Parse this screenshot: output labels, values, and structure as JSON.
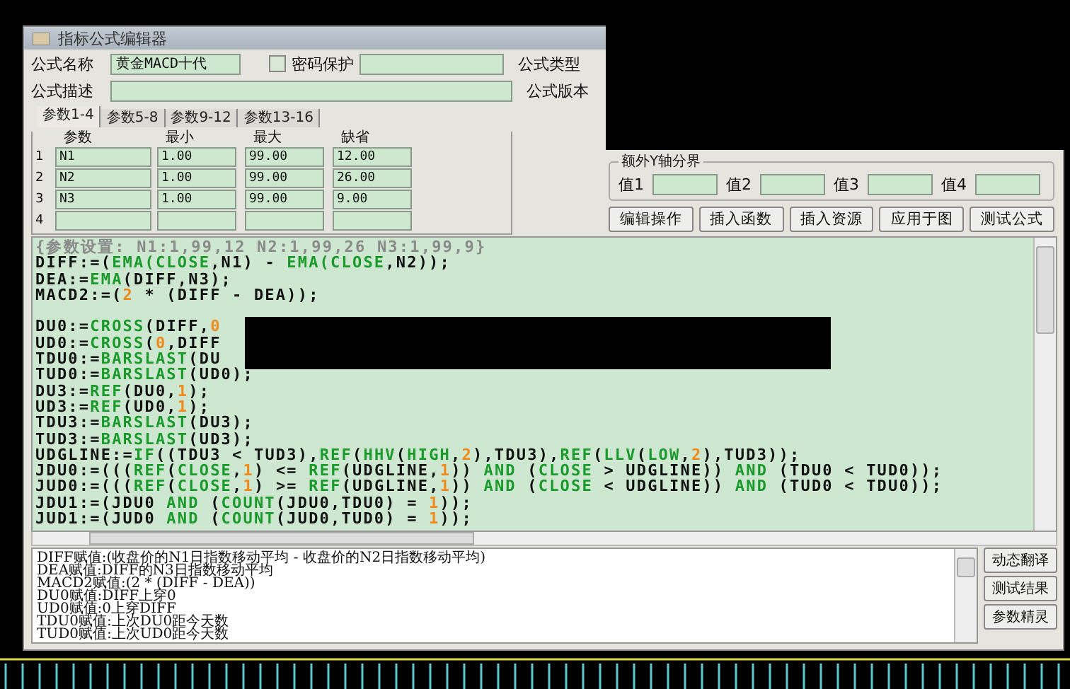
{
  "window": {
    "title": "指标公式编辑器"
  },
  "form": {
    "name_label": "公式名称",
    "name_value": "黄金MACD十代",
    "password": {
      "label": "密码保护",
      "checked": false
    },
    "type_label": "公式类型",
    "desc_label": "公式描述",
    "version_label": "公式版本"
  },
  "tabs": [
    {
      "label": "参数1-4",
      "selected": true
    },
    {
      "label": "参数5-8",
      "selected": false
    },
    {
      "label": "参数9-12",
      "selected": false
    },
    {
      "label": "参数13-16",
      "selected": false
    }
  ],
  "params": {
    "columns": [
      "参数",
      "最小",
      "最大",
      "缺省"
    ],
    "rows": [
      {
        "index": "1",
        "cells": [
          "N1",
          "1.00",
          "99.00",
          "12.00"
        ]
      },
      {
        "index": "2",
        "cells": [
          "N2",
          "1.00",
          "99.00",
          "26.00"
        ]
      },
      {
        "index": "3",
        "cells": [
          "N3",
          "1.00",
          "99.00",
          "9.00"
        ]
      },
      {
        "index": "4",
        "cells": []
      }
    ]
  },
  "y_axis": {
    "title": "额外Y轴分界",
    "values": [
      "值1",
      "值2",
      "值3",
      "值4"
    ]
  },
  "buttons": [
    "编辑操作",
    "插入函数",
    "插入资源",
    "应用于图",
    "测试公式"
  ],
  "code": {
    "lines": [
      {
        "kind": "code",
        "segments": [
          {
            "text": "{参数设置: N1:1,99,12 N2:1,99,26 N3:1,99,9}",
            "kind": "comment"
          }
        ]
      },
      {
        "kind": "code",
        "segments": [
          {
            "text": "DIFF:=(",
            "kind": "plain"
          },
          {
            "text": "EMA(CLOSE",
            "kind": "func"
          },
          {
            "text": ",N1) - ",
            "kind": "plain"
          },
          {
            "text": "EMA(CLOSE",
            "kind": "func"
          },
          {
            "text": ",N2));",
            "kind": "plain"
          }
        ]
      },
      {
        "kind": "code",
        "segments": [
          {
            "text": "DEA:=",
            "kind": "plain"
          },
          {
            "text": "EMA",
            "kind": "func"
          },
          {
            "text": "(DIFF,N3);",
            "kind": "plain"
          }
        ]
      },
      {
        "kind": "code",
        "segments": [
          {
            "text": "MACD2:=(",
            "kind": "plain"
          },
          {
            "text": "2",
            "kind": "num"
          },
          {
            "text": " * (DIFF - DEA));",
            "kind": "plain"
          }
        ]
      },
      {
        "kind": "blank"
      },
      {
        "kind": "code",
        "segments": [
          {
            "text": "DU0:=",
            "kind": "plain"
          },
          {
            "text": "CROSS",
            "kind": "func"
          },
          {
            "text": "(DIFF,",
            "kind": "plain"
          },
          {
            "text": "0",
            "kind": "num"
          }
        ]
      },
      {
        "kind": "code",
        "segments": [
          {
            "text": "UD0:=",
            "kind": "plain"
          },
          {
            "text": "CROSS",
            "kind": "func"
          },
          {
            "text": "(",
            "kind": "plain"
          },
          {
            "text": "0",
            "kind": "num"
          },
          {
            "text": ",DIFF",
            "kind": "plain"
          }
        ]
      },
      {
        "kind": "code",
        "segments": [
          {
            "text": "TDU0:=",
            "kind": "plain"
          },
          {
            "text": "BARSLAST",
            "kind": "func"
          },
          {
            "text": "(DU",
            "kind": "plain"
          }
        ]
      },
      {
        "kind": "code",
        "segments": [
          {
            "text": "TUD0:=",
            "kind": "plain"
          },
          {
            "text": "BARSLAST",
            "kind": "func"
          },
          {
            "text": "(UD0);",
            "kind": "plain"
          }
        ]
      },
      {
        "kind": "code",
        "segments": [
          {
            "text": "DU3:=",
            "kind": "plain"
          },
          {
            "text": "REF",
            "kind": "func"
          },
          {
            "text": "(DU0,",
            "kind": "plain"
          },
          {
            "text": "1",
            "kind": "num"
          },
          {
            "text": ");",
            "kind": "plain"
          }
        ]
      },
      {
        "kind": "code",
        "segments": [
          {
            "text": "UD3:=",
            "kind": "plain"
          },
          {
            "text": "REF",
            "kind": "func"
          },
          {
            "text": "(UD0,",
            "kind": "plain"
          },
          {
            "text": "1",
            "kind": "num"
          },
          {
            "text": ");",
            "kind": "plain"
          }
        ]
      },
      {
        "kind": "code",
        "segments": [
          {
            "text": "TDU3:=",
            "kind": "plain"
          },
          {
            "text": "BARSLAST",
            "kind": "func"
          },
          {
            "text": "(DU3);",
            "kind": "plain"
          }
        ]
      },
      {
        "kind": "code",
        "segments": [
          {
            "text": "TUD3:=",
            "kind": "plain"
          },
          {
            "text": "BARSLAST",
            "kind": "func"
          },
          {
            "text": "(UD3);",
            "kind": "plain"
          }
        ]
      },
      {
        "kind": "code",
        "segments": [
          {
            "text": "UDGLINE:=",
            "kind": "plain"
          },
          {
            "text": "IF",
            "kind": "func"
          },
          {
            "text": "((TDU3 < TUD3),",
            "kind": "plain"
          },
          {
            "text": "REF",
            "kind": "func"
          },
          {
            "text": "(",
            "kind": "plain"
          },
          {
            "text": "HHV",
            "kind": "func"
          },
          {
            "text": "(",
            "kind": "plain"
          },
          {
            "text": "HIGH",
            "kind": "func"
          },
          {
            "text": ",",
            "kind": "plain"
          },
          {
            "text": "2",
            "kind": "num"
          },
          {
            "text": "),TDU3),",
            "kind": "plain"
          },
          {
            "text": "REF",
            "kind": "func"
          },
          {
            "text": "(",
            "kind": "plain"
          },
          {
            "text": "LLV",
            "kind": "func"
          },
          {
            "text": "(",
            "kind": "plain"
          },
          {
            "text": "LOW",
            "kind": "func"
          },
          {
            "text": ",",
            "kind": "plain"
          },
          {
            "text": "2",
            "kind": "num"
          },
          {
            "text": "),TUD3));",
            "kind": "plain"
          }
        ]
      },
      {
        "kind": "code",
        "segments": [
          {
            "text": "JDU0:=(((",
            "kind": "plain"
          },
          {
            "text": "REF",
            "kind": "func"
          },
          {
            "text": "(",
            "kind": "plain"
          },
          {
            "text": "CLOSE",
            "kind": "func"
          },
          {
            "text": ",",
            "kind": "plain"
          },
          {
            "text": "1",
            "kind": "num"
          },
          {
            "text": ") <= ",
            "kind": "plain"
          },
          {
            "text": "REF",
            "kind": "func"
          },
          {
            "text": "(UDGLINE,",
            "kind": "plain"
          },
          {
            "text": "1",
            "kind": "num"
          },
          {
            "text": ")) ",
            "kind": "plain"
          },
          {
            "text": "AND",
            "kind": "func"
          },
          {
            "text": " (",
            "kind": "plain"
          },
          {
            "text": "CLOSE",
            "kind": "func"
          },
          {
            "text": " > UDGLINE)) ",
            "kind": "plain"
          },
          {
            "text": "AND",
            "kind": "func"
          },
          {
            "text": " (TDU0 < TUD0));",
            "kind": "plain"
          }
        ]
      },
      {
        "kind": "code",
        "segments": [
          {
            "text": "JUD0:=(((",
            "kind": "plain"
          },
          {
            "text": "REF",
            "kind": "func"
          },
          {
            "text": "(",
            "kind": "plain"
          },
          {
            "text": "CLOSE",
            "kind": "func"
          },
          {
            "text": ",",
            "kind": "plain"
          },
          {
            "text": "1",
            "kind": "num"
          },
          {
            "text": ") >= ",
            "kind": "plain"
          },
          {
            "text": "REF",
            "kind": "func"
          },
          {
            "text": "(UDGLINE,",
            "kind": "plain"
          },
          {
            "text": "1",
            "kind": "num"
          },
          {
            "text": ")) ",
            "kind": "plain"
          },
          {
            "text": "AND",
            "kind": "func"
          },
          {
            "text": " (",
            "kind": "plain"
          },
          {
            "text": "CLOSE",
            "kind": "func"
          },
          {
            "text": " < UDGLINE)) ",
            "kind": "plain"
          },
          {
            "text": "AND",
            "kind": "func"
          },
          {
            "text": " (TUD0 < TDU0));",
            "kind": "plain"
          }
        ]
      },
      {
        "kind": "code",
        "segments": [
          {
            "text": "JDU1:=(JDU0 ",
            "kind": "plain"
          },
          {
            "text": "AND",
            "kind": "func"
          },
          {
            "text": " (",
            "kind": "plain"
          },
          {
            "text": "COUNT",
            "kind": "func"
          },
          {
            "text": "(JDU0,TDU0) = ",
            "kind": "plain"
          },
          {
            "text": "1",
            "kind": "num"
          },
          {
            "text": "));",
            "kind": "plain"
          }
        ]
      },
      {
        "kind": "code",
        "segments": [
          {
            "text": "JUD1:=(JUD0 ",
            "kind": "plain"
          },
          {
            "text": "AND",
            "kind": "func"
          },
          {
            "text": " (",
            "kind": "plain"
          },
          {
            "text": "COUNT",
            "kind": "func"
          },
          {
            "text": "(JUD0,TUD0) = ",
            "kind": "plain"
          },
          {
            "text": "1",
            "kind": "num"
          },
          {
            "text": "));",
            "kind": "plain"
          }
        ]
      }
    ]
  },
  "output": {
    "lines": [
      "DIFF赋值:(收盘价的N1日指数移动平均 - 收盘价的N2日指数移动平均)",
      "DEA赋值:DIFF的N3日指数移动平均",
      "MACD2赋值:(2 * (DIFF - DEA))",
      "DU0赋值:DIFF上穿0",
      "UD0赋值:0上穿DIFF",
      "TDU0赋值:上次DU0距今天数",
      "TUD0赋值:上次UD0距今天数"
    ]
  },
  "side_buttons": [
    "动态翻译",
    "测试结果",
    "参数精灵"
  ]
}
